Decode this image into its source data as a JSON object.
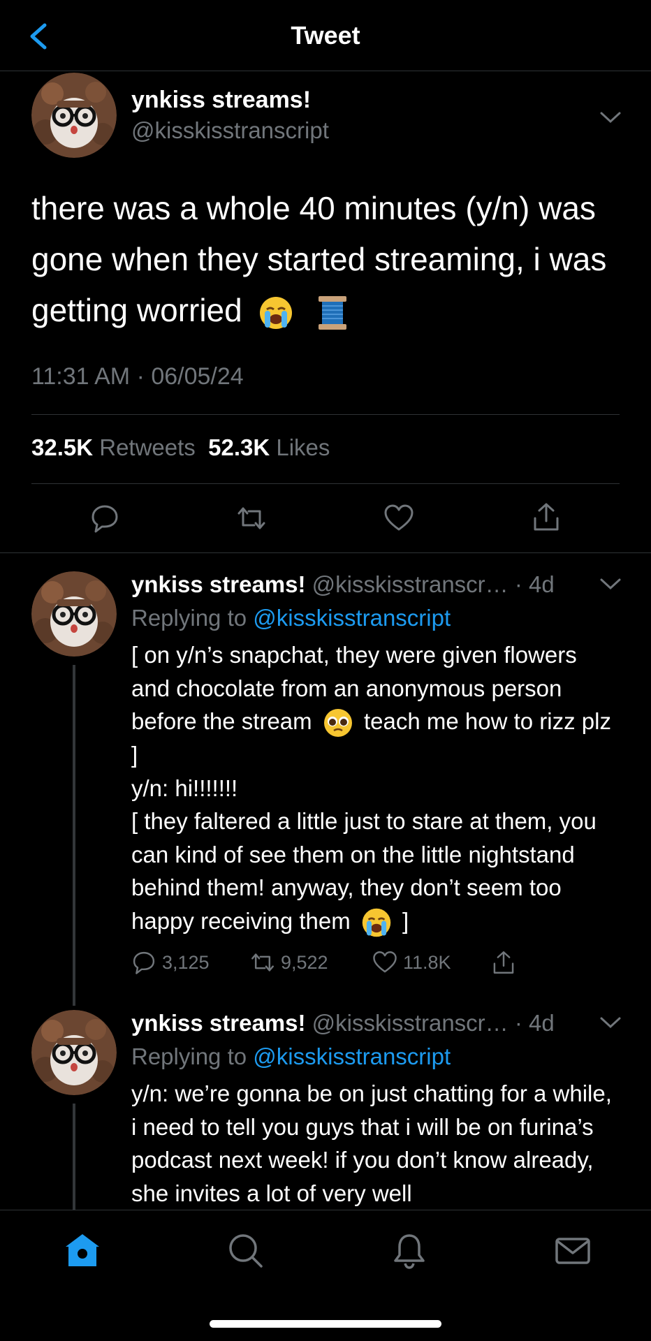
{
  "header": {
    "title": "Tweet"
  },
  "main_tweet": {
    "name": "ynkiss streams!",
    "handle": "@kisskisstranscript",
    "text": "there was a whole 40 minutes (y/n) was gone when they started streaming, i was getting worried",
    "emojis": [
      "loudly-crying-face",
      "thread-spool"
    ],
    "timestamp": "11:31 AM · 06/05/24",
    "retweets_count": "32.5K",
    "retweets_label": "Retweets",
    "likes_count": "52.3K",
    "likes_label": "Likes"
  },
  "replies": [
    {
      "name": "ynkiss streams!",
      "handle": "@kisskisstranscr…",
      "time": "· 4d",
      "replying_prefix": "Replying to",
      "replying_to": "@kisskisstranscript",
      "body_part1": "[ on y/n’s snapchat, they were given flowers and chocolate from an anonymous person before the stream",
      "body_part2": "teach me how to rizz plz ]\ny/n: hi!!!!!!!\n[ they faltered a little just to stare at them, you can kind of see them on the little nightstand behind them! anyway, they don’t seem too happy receiving them",
      "body_part3": "]",
      "reply_count": "3,125",
      "retweet_count": "9,522",
      "like_count": "11.8K"
    },
    {
      "name": "ynkiss streams!",
      "handle": "@kisskisstranscr…",
      "time": "· 4d",
      "replying_prefix": "Replying to",
      "replying_to": "@kisskisstranscript",
      "body": "y/n: we’re gonna be on just chatting for a while, i need to tell you guys that i will be on furina’s podcast next week! if you don’t know already, she invites a lot of very well"
    }
  ],
  "tabs": [
    "home-icon",
    "search-icon",
    "notifications-icon",
    "messages-icon"
  ],
  "colors": {
    "accent": "#1d9bf0",
    "muted": "#71767b",
    "background": "#000000"
  }
}
